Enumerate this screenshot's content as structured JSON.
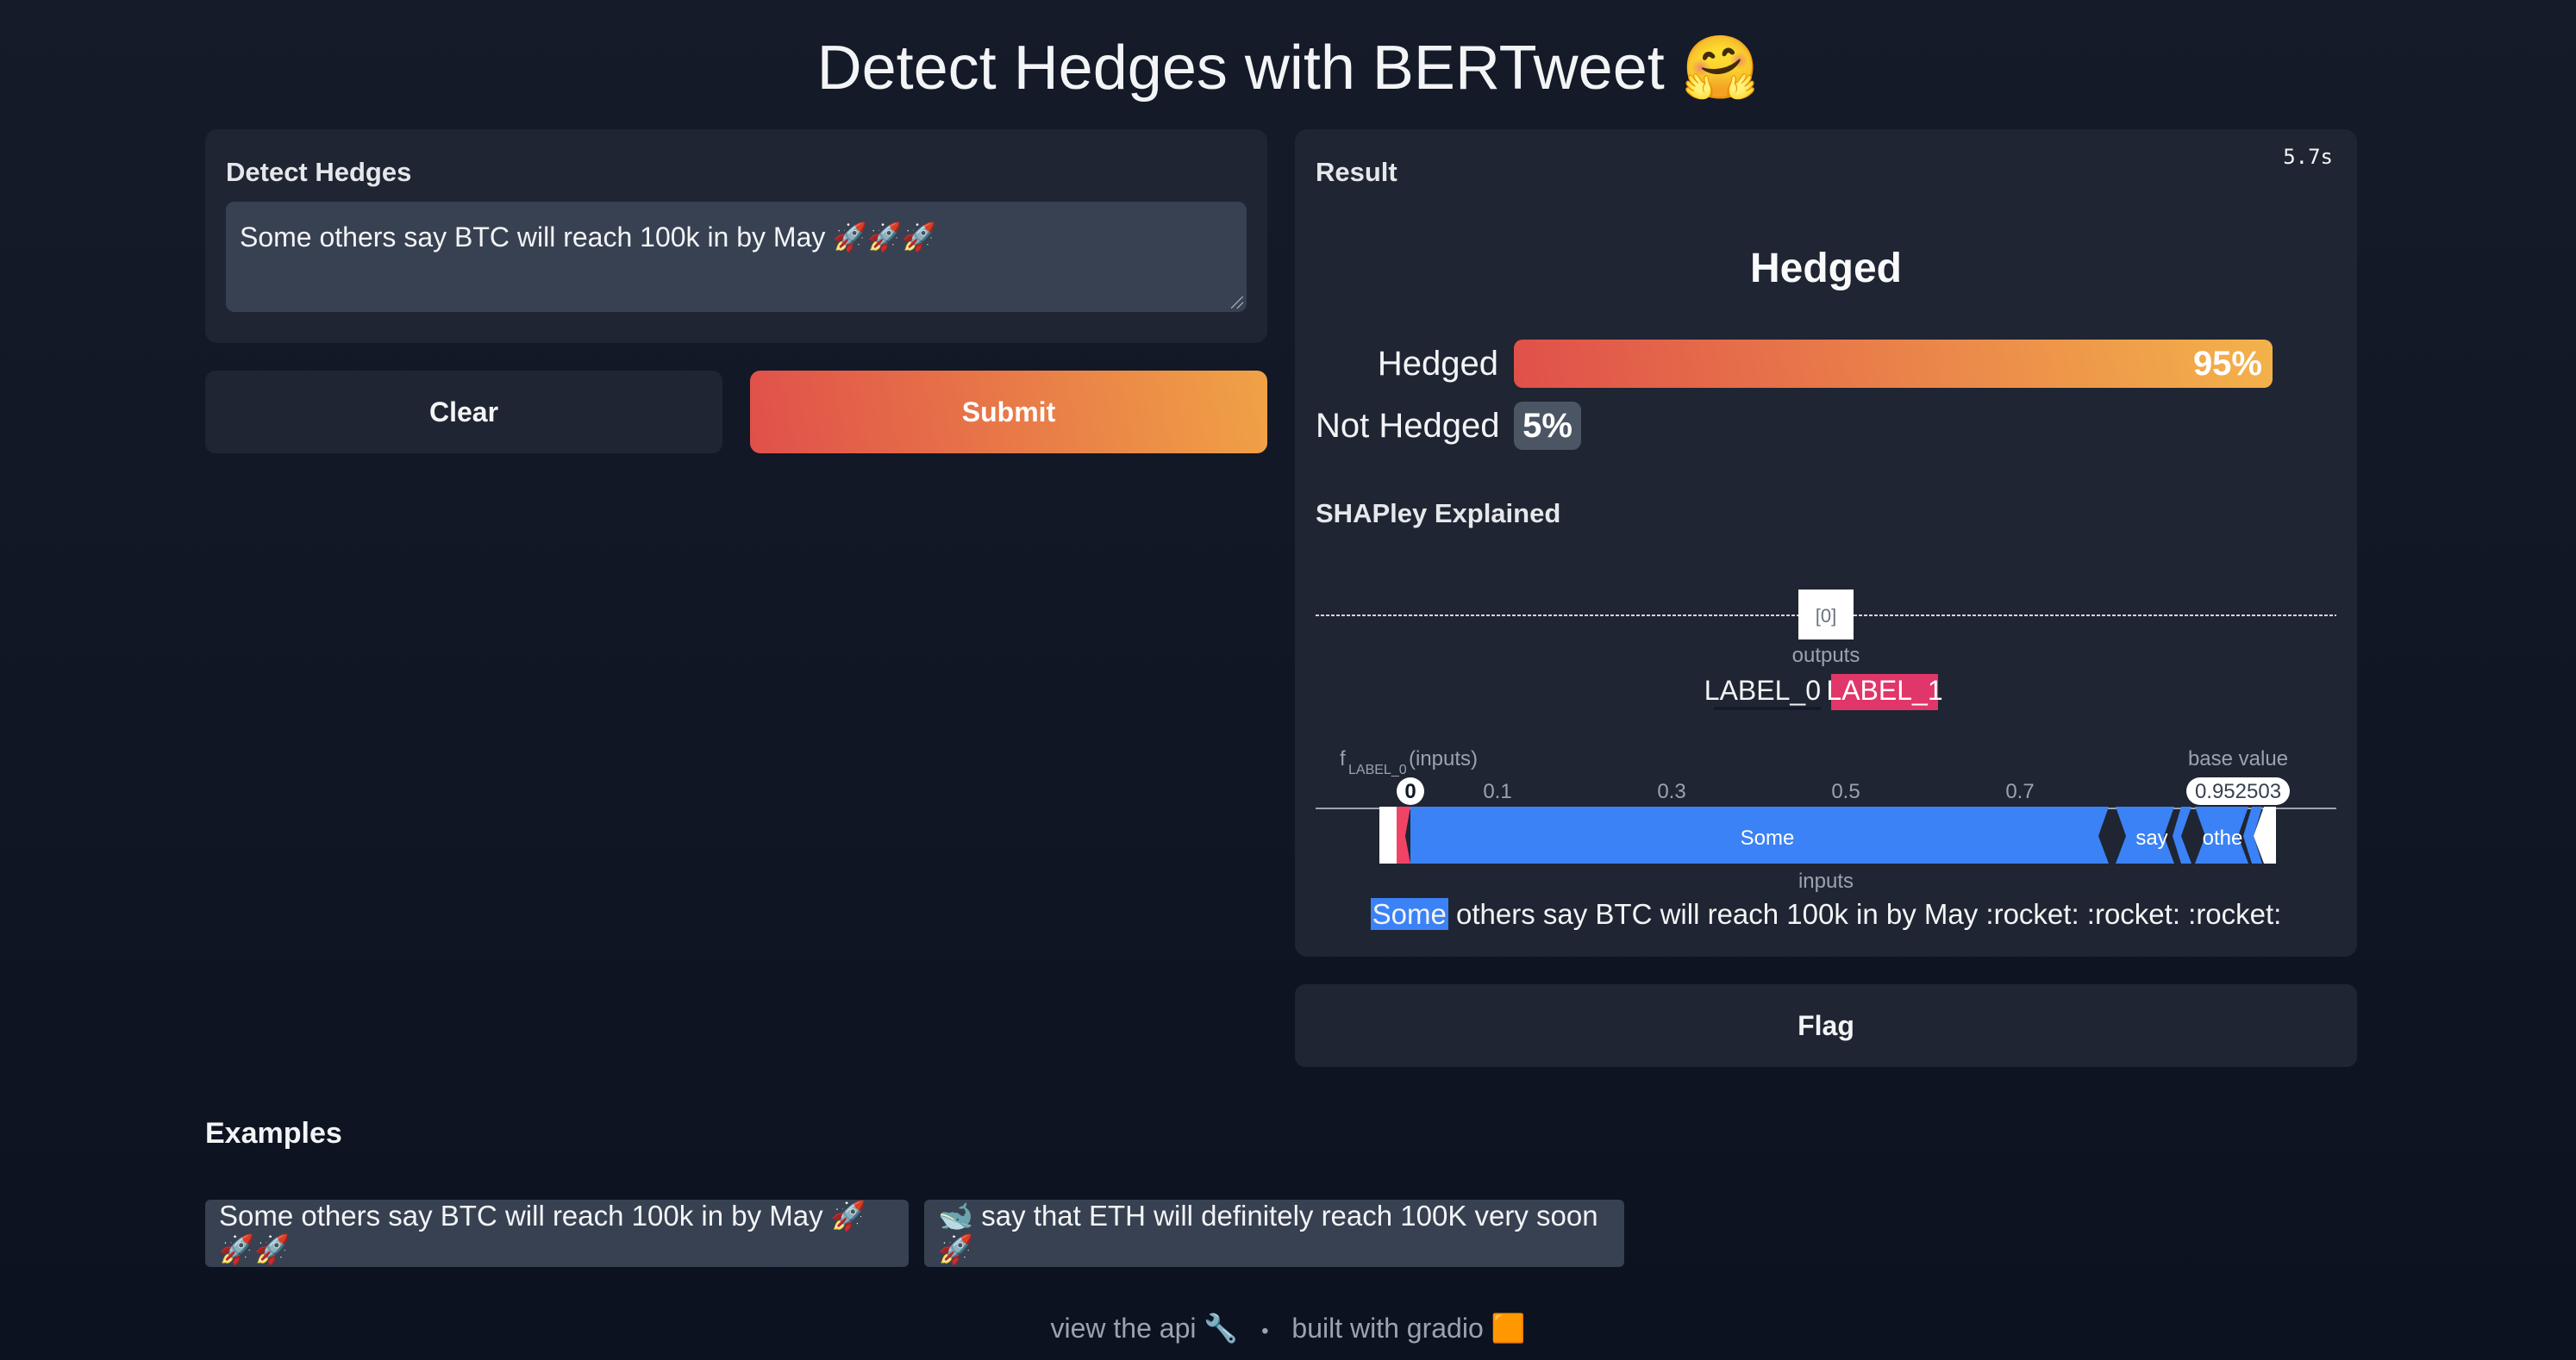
{
  "app": {
    "title": "Detect Hedges with BERTweet 🤗"
  },
  "input": {
    "label": "Detect Hedges",
    "value": "Some others say BTC will reach 100k in by May 🚀🚀🚀"
  },
  "buttons": {
    "clear": "Clear",
    "submit": "Submit",
    "flag": "Flag"
  },
  "result": {
    "label": "Result",
    "elapsed": "5.7s",
    "predicted": "Hedged",
    "confidences": [
      {
        "label": "Hedged",
        "value": 0.95,
        "display": "95%"
      },
      {
        "label": "Not Hedged",
        "value": 0.05,
        "display": "5%"
      }
    ]
  },
  "shap": {
    "label": "SHAPley Explained",
    "output_select": "[0]",
    "outputs_caption": "outputs",
    "output_labels": [
      "LABEL_0",
      "LABEL_1"
    ],
    "f_label_main": "f",
    "f_label_sub": "LABEL_0",
    "f_label_suffix": "(inputs)",
    "base_value_caption": "base value",
    "base_value": "0.952503",
    "fx_value": "0",
    "ticks": [
      "0.1",
      "0.3",
      "0.5",
      "0.7"
    ],
    "inputs_caption": "inputs",
    "segments": [
      "Some",
      "say",
      "othe"
    ],
    "highlight_word": "Some",
    "text_rest": " others say BTC will reach 100k in by May :rocket: :rocket: :rocket:",
    "colors": {
      "negative": "#3b82f6",
      "positive": "#ef4466"
    }
  },
  "examples": {
    "label": "Examples",
    "items": [
      "Some others say BTC will reach 100k in by May 🚀🚀🚀",
      "🐋 say that ETH will definitely reach 100K very soon 🚀"
    ]
  },
  "footer": {
    "api": "view the api 🔧",
    "sep": "•",
    "built": "built with gradio 🟧"
  }
}
